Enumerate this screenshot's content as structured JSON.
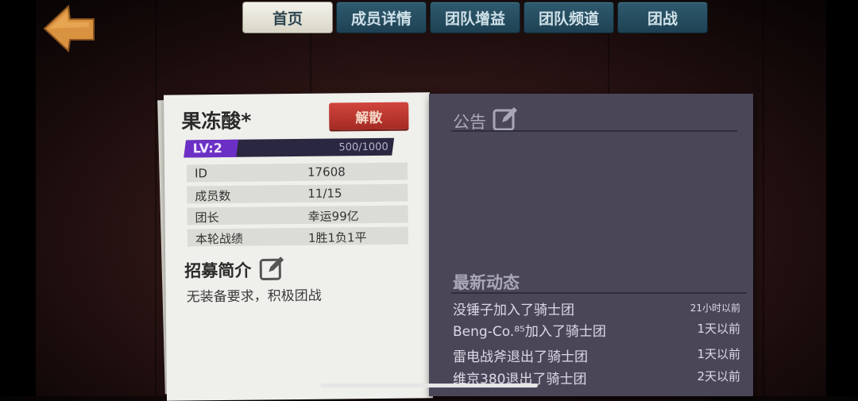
{
  "colors": {
    "accent_purple": "#6b2fc5",
    "disband_red": "#c23a31",
    "tab_blue": "#2a5366",
    "board": "#4a4658"
  },
  "back_button": {
    "icon": "arrow-left-icon"
  },
  "tabs": [
    {
      "label": "首页",
      "active": true
    },
    {
      "label": "成员详情",
      "active": false
    },
    {
      "label": "团队增益",
      "active": false
    },
    {
      "label": "团队频道",
      "active": false
    },
    {
      "label": "团战",
      "active": false
    }
  ],
  "guild": {
    "name": "果冻酸*",
    "disband_label": "解散",
    "level_label": "LV:2",
    "xp_text": "500/1000",
    "xp_progress": 0.25,
    "info": [
      {
        "key": "ID",
        "value": "17608"
      },
      {
        "key": "成员数",
        "value": "11/15"
      },
      {
        "key": "团长",
        "value": "幸运99亿"
      },
      {
        "key": "本轮战绩",
        "value": "1胜1负1平"
      }
    ],
    "recruit_title": "招募简介",
    "recruit_text": "无装备要求，积极团战"
  },
  "notice": {
    "title": "公告",
    "content": ""
  },
  "news": {
    "title": "最新动态",
    "items": [
      {
        "text": "没锤子加入了骑士团",
        "ago": "21小时以前"
      },
      {
        "text": "Beng-Co.⁸⁵加入了骑士团",
        "ago": "1天以前"
      },
      {
        "text": "雷电战斧退出了骑士团",
        "ago": "1天以前"
      },
      {
        "text": "维京380退出了骑士团",
        "ago": "2天以前"
      }
    ]
  }
}
